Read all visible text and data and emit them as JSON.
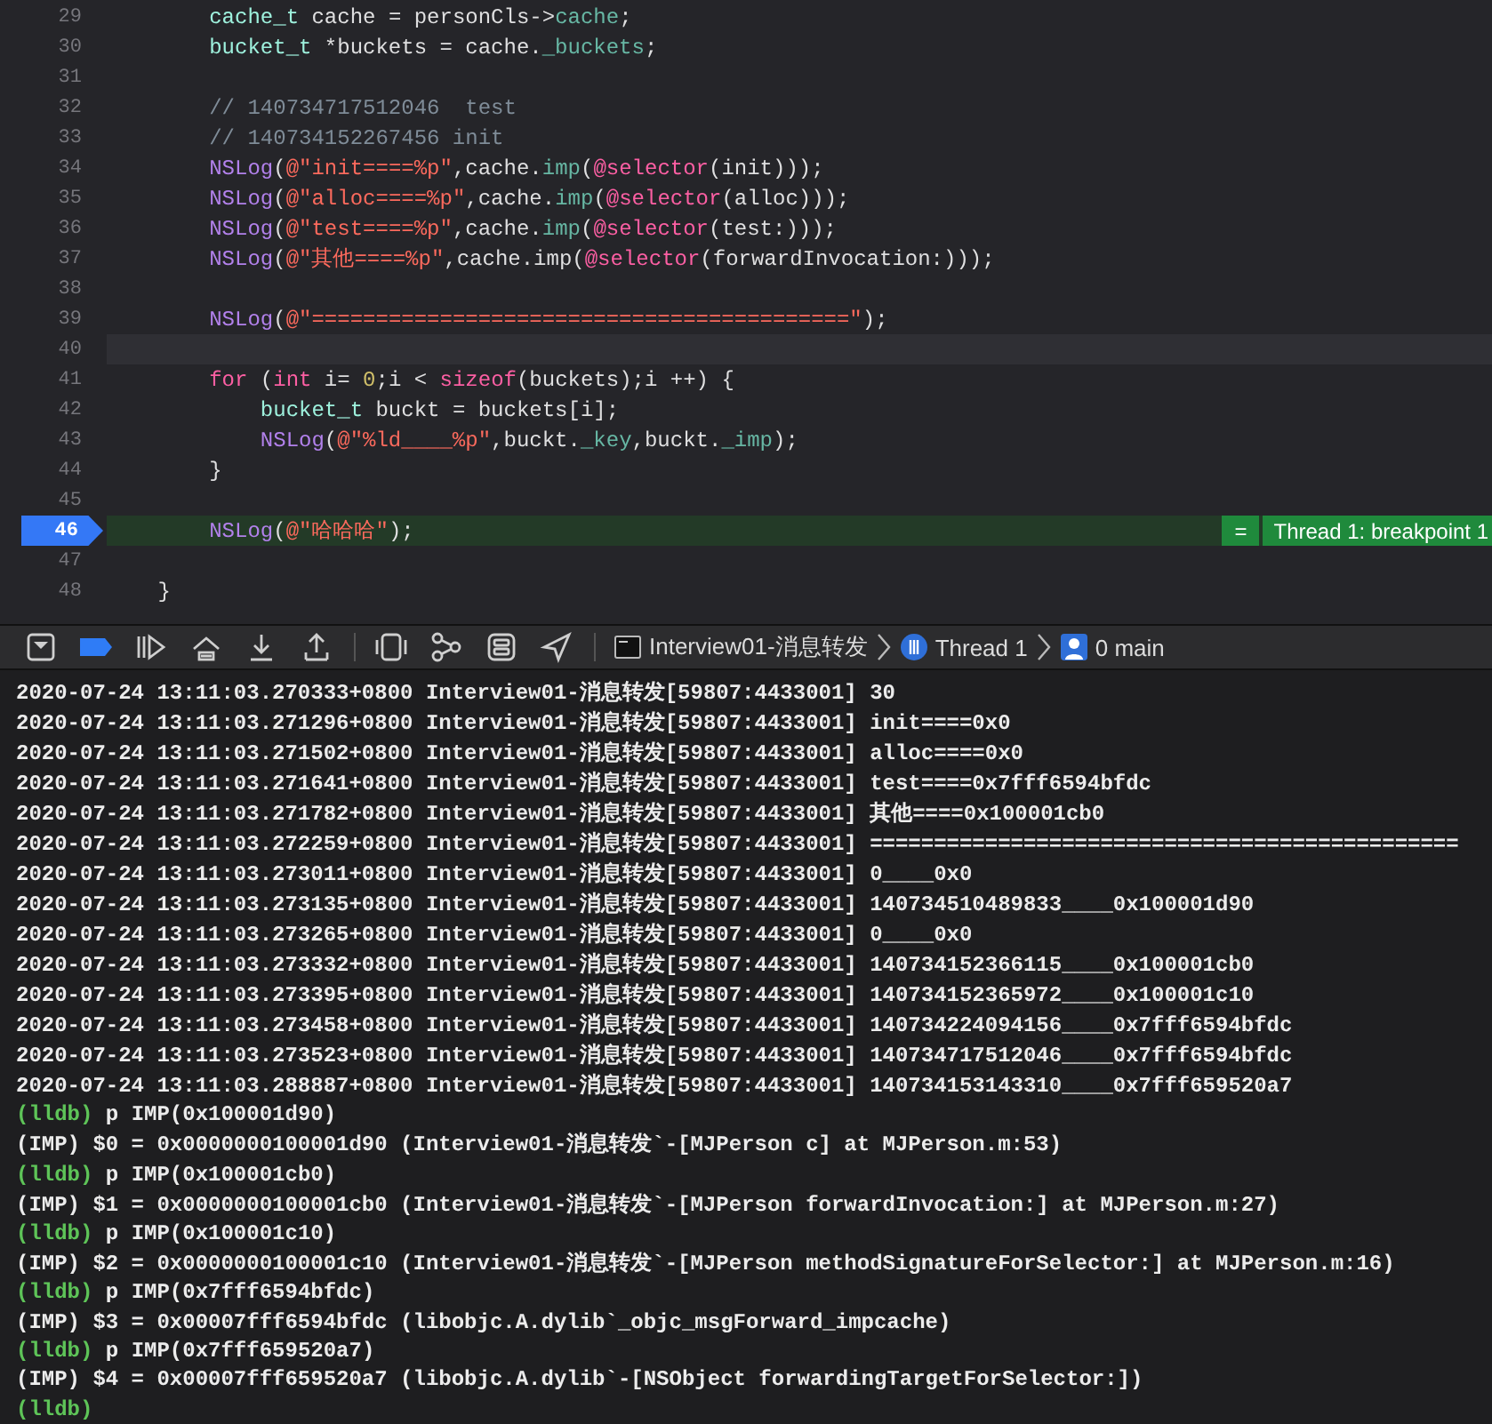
{
  "editor": {
    "lines": [
      {
        "number": "29",
        "kind": "normal",
        "tokens": [
          {
            "kind": "type",
            "text": "        cache_t"
          },
          {
            "kind": "plain",
            "text": " cache = personCls->"
          },
          {
            "kind": "prop",
            "text": "cache"
          },
          {
            "kind": "plain",
            "text": ";"
          }
        ]
      },
      {
        "number": "30",
        "kind": "normal",
        "tokens": [
          {
            "kind": "type",
            "text": "        bucket_t"
          },
          {
            "kind": "plain",
            "text": " *buckets = cache."
          },
          {
            "kind": "prop",
            "text": "_buckets"
          },
          {
            "kind": "plain",
            "text": ";"
          }
        ]
      },
      {
        "number": "31",
        "kind": "normal"
      },
      {
        "number": "32",
        "kind": "normal",
        "tokens": [
          {
            "kind": "comment",
            "text": "        // 140734717512046  test"
          }
        ]
      },
      {
        "number": "33",
        "kind": "normal",
        "tokens": [
          {
            "kind": "comment",
            "text": "        // 140734152267456 init"
          }
        ]
      },
      {
        "number": "34",
        "kind": "normal",
        "tokens": [
          {
            "kind": "func",
            "text": "        NSLog"
          },
          {
            "kind": "plain",
            "text": "("
          },
          {
            "kind": "string",
            "text": "@\"init====%p\""
          },
          {
            "kind": "plain",
            "text": ",cache."
          },
          {
            "kind": "prop",
            "text": "imp"
          },
          {
            "kind": "plain",
            "text": "("
          },
          {
            "kind": "keyword",
            "text": "@selector"
          },
          {
            "kind": "plain",
            "text": "(init)));"
          }
        ]
      },
      {
        "number": "35",
        "kind": "normal",
        "tokens": [
          {
            "kind": "func",
            "text": "        NSLog"
          },
          {
            "kind": "plain",
            "text": "("
          },
          {
            "kind": "string",
            "text": "@\"alloc====%p\""
          },
          {
            "kind": "plain",
            "text": ",cache."
          },
          {
            "kind": "prop",
            "text": "imp"
          },
          {
            "kind": "plain",
            "text": "("
          },
          {
            "kind": "keyword",
            "text": "@selector"
          },
          {
            "kind": "plain",
            "text": "(alloc)));"
          }
        ]
      },
      {
        "number": "36",
        "kind": "normal",
        "tokens": [
          {
            "kind": "func",
            "text": "        NSLog"
          },
          {
            "kind": "plain",
            "text": "("
          },
          {
            "kind": "string",
            "text": "@\"test====%p\""
          },
          {
            "kind": "plain",
            "text": ",cache."
          },
          {
            "kind": "prop",
            "text": "imp"
          },
          {
            "kind": "plain",
            "text": "("
          },
          {
            "kind": "keyword",
            "text": "@selector"
          },
          {
            "kind": "plain",
            "text": "(test:)));"
          }
        ]
      },
      {
        "number": "37",
        "kind": "normal",
        "tokens": [
          {
            "kind": "func",
            "text": "        NSLog"
          },
          {
            "kind": "plain",
            "text": "("
          },
          {
            "kind": "string",
            "text": "@\"其他====%p\""
          },
          {
            "kind": "plain",
            "text": ",cache.imp("
          },
          {
            "kind": "keyword",
            "text": "@selector"
          },
          {
            "kind": "plain",
            "text": "(forwardInvocation:)));"
          }
        ]
      },
      {
        "number": "38",
        "kind": "normal"
      },
      {
        "number": "39",
        "kind": "normal",
        "tokens": [
          {
            "kind": "func",
            "text": "        NSLog"
          },
          {
            "kind": "plain",
            "text": "("
          },
          {
            "kind": "string",
            "text": "@\"==========================================\""
          },
          {
            "kind": "plain",
            "text": ");"
          }
        ]
      },
      {
        "number": "40",
        "kind": "cursor"
      },
      {
        "number": "41",
        "kind": "normal",
        "tokens": [
          {
            "kind": "keyword",
            "text": "        for"
          },
          {
            "kind": "plain",
            "text": " ("
          },
          {
            "kind": "keyword",
            "text": "int"
          },
          {
            "kind": "plain",
            "text": " i= "
          },
          {
            "kind": "number",
            "text": "0"
          },
          {
            "kind": "plain",
            "text": ";i < "
          },
          {
            "kind": "keyword",
            "text": "sizeof"
          },
          {
            "kind": "plain",
            "text": "(buckets);i ++) {"
          }
        ]
      },
      {
        "number": "42",
        "kind": "normal",
        "tokens": [
          {
            "kind": "type",
            "text": "            bucket_t"
          },
          {
            "kind": "plain",
            "text": " buckt = buckets[i];"
          }
        ]
      },
      {
        "number": "43",
        "kind": "normal",
        "tokens": [
          {
            "kind": "func",
            "text": "            NSLog"
          },
          {
            "kind": "plain",
            "text": "("
          },
          {
            "kind": "string",
            "text": "@\"%ld____%p\""
          },
          {
            "kind": "plain",
            "text": ",buckt."
          },
          {
            "kind": "prop",
            "text": "_key"
          },
          {
            "kind": "plain",
            "text": ",buckt."
          },
          {
            "kind": "prop",
            "text": "_imp"
          },
          {
            "kind": "plain",
            "text": ");"
          }
        ]
      },
      {
        "number": "44",
        "kind": "normal",
        "tokens": [
          {
            "kind": "plain",
            "text": "        }"
          }
        ]
      },
      {
        "number": "45",
        "kind": "normal"
      },
      {
        "number": "46",
        "kind": "breakpoint",
        "tokens": [
          {
            "kind": "func",
            "text": "        NSLog"
          },
          {
            "kind": "plain",
            "text": "("
          },
          {
            "kind": "string",
            "text": "@\"哈哈哈\""
          },
          {
            "kind": "plain",
            "text": ");"
          }
        ],
        "badge": {
          "symbol": "=",
          "text": "Thread 1: breakpoint 1"
        }
      },
      {
        "number": "47",
        "kind": "normal"
      },
      {
        "number": "48",
        "kind": "normal",
        "tokens": [
          {
            "kind": "plain",
            "text": "    }"
          }
        ]
      }
    ]
  },
  "debug_bar": {
    "breakpoints_active": true,
    "breadcrumbs": [
      {
        "kind": "target",
        "label": "Interview01-消息转发"
      },
      {
        "kind": "thread",
        "label": "Thread 1"
      },
      {
        "kind": "frame",
        "label": "0 main"
      }
    ]
  },
  "console": {
    "lines": [
      {
        "kind": "log",
        "text": "2020-07-24 13:11:03.270333+0800 Interview01-消息转发[59807:4433001] 30"
      },
      {
        "kind": "log",
        "text": "2020-07-24 13:11:03.271296+0800 Interview01-消息转发[59807:4433001] init====0x0"
      },
      {
        "kind": "log",
        "text": "2020-07-24 13:11:03.271502+0800 Interview01-消息转发[59807:4433001] alloc====0x0"
      },
      {
        "kind": "log",
        "text": "2020-07-24 13:11:03.271641+0800 Interview01-消息转发[59807:4433001] test====0x7fff6594bfdc"
      },
      {
        "kind": "log",
        "text": "2020-07-24 13:11:03.271782+0800 Interview01-消息转发[59807:4433001] 其他====0x100001cb0"
      },
      {
        "kind": "log",
        "text": "2020-07-24 13:11:03.272259+0800 Interview01-消息转发[59807:4433001] =============================================="
      },
      {
        "kind": "log",
        "text": "2020-07-24 13:11:03.273011+0800 Interview01-消息转发[59807:4433001] 0____0x0"
      },
      {
        "kind": "log",
        "text": "2020-07-24 13:11:03.273135+0800 Interview01-消息转发[59807:4433001] 140734510489833____0x100001d90"
      },
      {
        "kind": "log",
        "text": "2020-07-24 13:11:03.273265+0800 Interview01-消息转发[59807:4433001] 0____0x0"
      },
      {
        "kind": "log",
        "text": "2020-07-24 13:11:03.273332+0800 Interview01-消息转发[59807:4433001] 140734152366115____0x100001cb0"
      },
      {
        "kind": "log",
        "text": "2020-07-24 13:11:03.273395+0800 Interview01-消息转发[59807:4433001] 140734152365972____0x100001c10"
      },
      {
        "kind": "log",
        "text": "2020-07-24 13:11:03.273458+0800 Interview01-消息转发[59807:4433001] 140734224094156____0x7fff6594bfdc"
      },
      {
        "kind": "log",
        "text": "2020-07-24 13:11:03.273523+0800 Interview01-消息转发[59807:4433001] 140734717512046____0x7fff6594bfdc"
      },
      {
        "kind": "log",
        "text": "2020-07-24 13:11:03.288887+0800 Interview01-消息转发[59807:4433001] 140734153143310____0x7fff659520a7"
      },
      {
        "kind": "prompt",
        "prompt": "(lldb)",
        "text": "p IMP(0x100001d90)"
      },
      {
        "kind": "log",
        "text": "(IMP) $0 = 0x0000000100001d90 (Interview01-消息转发`-[MJPerson c] at MJPerson.m:53)"
      },
      {
        "kind": "prompt",
        "prompt": "(lldb)",
        "text": "p IMP(0x100001cb0)"
      },
      {
        "kind": "log",
        "text": "(IMP) $1 = 0x0000000100001cb0 (Interview01-消息转发`-[MJPerson forwardInvocation:] at MJPerson.m:27)"
      },
      {
        "kind": "prompt",
        "prompt": "(lldb)",
        "text": "p IMP(0x100001c10)"
      },
      {
        "kind": "log",
        "text": "(IMP) $2 = 0x0000000100001c10 (Interview01-消息转发`-[MJPerson methodSignatureForSelector:] at MJPerson.m:16)"
      },
      {
        "kind": "prompt",
        "prompt": "(lldb)",
        "text": "p IMP(0x7fff6594bfdc)"
      },
      {
        "kind": "log",
        "text": "(IMP) $3 = 0x00007fff6594bfdc (libobjc.A.dylib`_objc_msgForward_impcache)"
      },
      {
        "kind": "prompt",
        "prompt": "(lldb)",
        "text": "p IMP(0x7fff659520a7)"
      },
      {
        "kind": "log",
        "text": "(IMP) $4 = 0x00007fff659520a7 (libobjc.A.dylib`-[NSObject forwardingTargetForSelector:])"
      },
      {
        "kind": "prompt",
        "prompt": "(lldb)"
      }
    ]
  }
}
